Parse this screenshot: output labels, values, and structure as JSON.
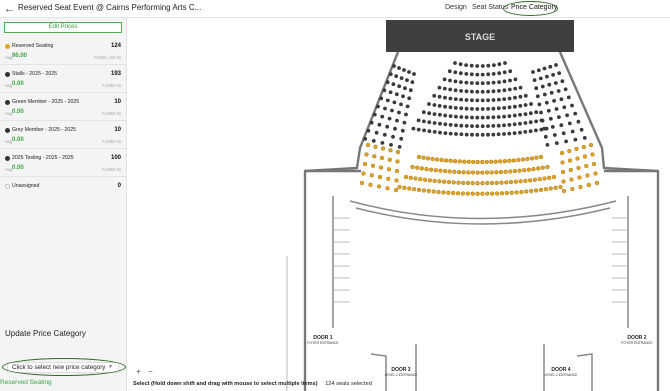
{
  "header": {
    "back_icon": "arrow-left-icon",
    "title": "Reserved Seat Event @ Cairns Performing Arts C...",
    "tabs": [
      {
        "label": "Design",
        "active": false
      },
      {
        "label": "Seat Status",
        "active": false
      },
      {
        "label": "Price Category",
        "active": true
      }
    ]
  },
  "sidebar": {
    "edit_prices_label": "Edit Prices",
    "categories": [
      {
        "name": "Reserved Seating",
        "count": "124",
        "avg_label": "Avg",
        "avg_price": "90.00",
        "currency": "AUD$1,160.00",
        "color": "#e3a520"
      },
      {
        "name": "Stalls - 2025 - 2025",
        "count": "193",
        "avg_label": "Avg",
        "avg_price": "0.00",
        "currency": "AUD$0.00",
        "color": "#333333"
      },
      {
        "name": "Green Member - 2025 - 2025",
        "count": "10",
        "avg_label": "Avg",
        "avg_price": "0.00",
        "currency": "AUD$0.00",
        "color": "#333333"
      },
      {
        "name": "Grey Member - 2025 - 2025",
        "count": "10",
        "avg_label": "Avg",
        "avg_price": "0.00",
        "currency": "AUD$0.00",
        "color": "#333333"
      },
      {
        "name": "2025 Testing - 2025 - 2025",
        "count": "100",
        "avg_label": "Avg",
        "avg_price": "0.00",
        "currency": "AUD$0.00",
        "color": "#333333"
      }
    ],
    "unassigned": {
      "name": "Unassigned",
      "count": "0"
    },
    "update_title": "Update Price Category",
    "select_placeholder": "Click to select new price category",
    "selected_category": "Reserved Seating"
  },
  "map": {
    "stage_label": "STAGE",
    "stage_color": "#3e3e3e",
    "seat_dark_color": "#3a3a3a",
    "seat_selected_color": "#e3a520",
    "doors": [
      {
        "title": "DOOR 1",
        "subtitle": "FOYER ENTRANCE"
      },
      {
        "title": "DOOR 2",
        "subtitle": "FOYER ENTRANCE"
      },
      {
        "title": "DOOR 3",
        "subtitle": "LEVEL 1 ENTRANCE"
      },
      {
        "title": "DOOR 4",
        "subtitle": "LEVEL 1 ENTRANCE"
      }
    ],
    "zoom_in": "+",
    "zoom_out": "−"
  },
  "status_bar": {
    "hint": "Select (Hold down shift and drag with mouse to select multiple items)",
    "selected_count": "124 seats selected"
  }
}
